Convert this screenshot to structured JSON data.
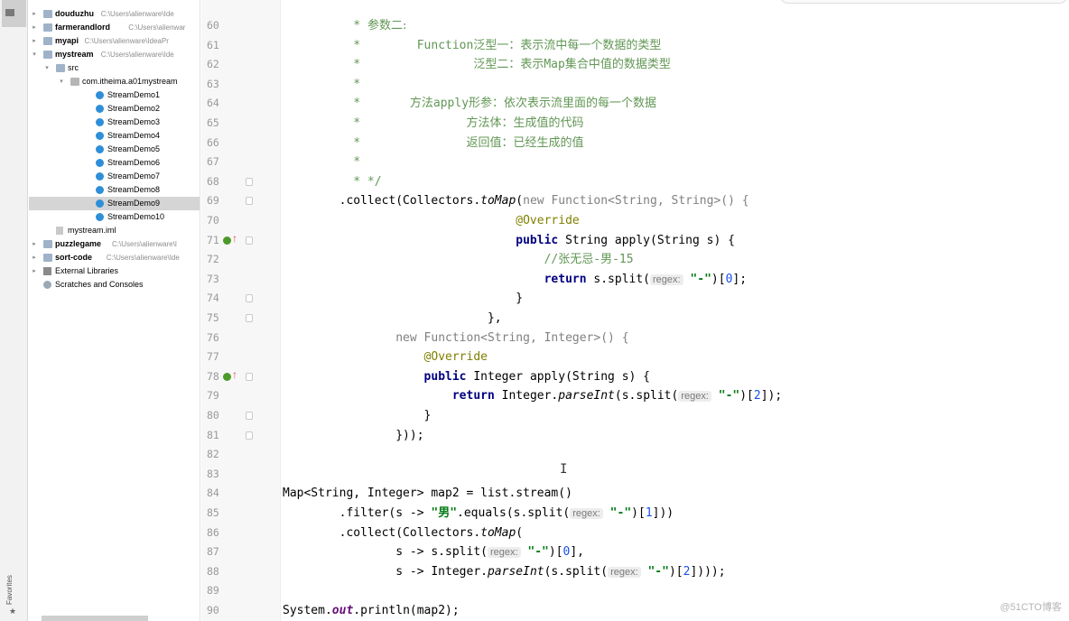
{
  "sidebar": {
    "favorites_label": "Favorites",
    "tree": [
      {
        "label": "douduzhu",
        "path": "C:\\Users\\alienware\\Ide",
        "bold": true,
        "level": 0,
        "icon": "folder-icon",
        "arrow": "right"
      },
      {
        "label": "farmerandlord",
        "path": "C:\\Users\\alienwar",
        "bold": true,
        "level": 0,
        "icon": "folder-icon",
        "arrow": "right"
      },
      {
        "label": "myapi",
        "path": "C:\\Users\\alienware\\IdeaPr",
        "bold": true,
        "level": 0,
        "icon": "folder-icon",
        "arrow": "right"
      },
      {
        "label": "mystream",
        "path": "C:\\Users\\alienware\\Ide",
        "bold": true,
        "level": 0,
        "icon": "folder-icon",
        "arrow": "down"
      },
      {
        "label": "src",
        "path": "",
        "bold": false,
        "level": 1,
        "icon": "folder-icon",
        "arrow": "down"
      },
      {
        "label": "com.itheima.a01mystream",
        "path": "",
        "bold": false,
        "level": 2,
        "icon": "package-icon",
        "arrow": "down"
      },
      {
        "label": "StreamDemo1",
        "path": "",
        "bold": false,
        "level": 3,
        "icon": "class-icon",
        "arrow": ""
      },
      {
        "label": "StreamDemo2",
        "path": "",
        "bold": false,
        "level": 3,
        "icon": "class-icon",
        "arrow": ""
      },
      {
        "label": "StreamDemo3",
        "path": "",
        "bold": false,
        "level": 3,
        "icon": "class-icon",
        "arrow": ""
      },
      {
        "label": "StreamDemo4",
        "path": "",
        "bold": false,
        "level": 3,
        "icon": "class-icon",
        "arrow": ""
      },
      {
        "label": "StreamDemo5",
        "path": "",
        "bold": false,
        "level": 3,
        "icon": "class-icon",
        "arrow": ""
      },
      {
        "label": "StreamDemo6",
        "path": "",
        "bold": false,
        "level": 3,
        "icon": "class-icon",
        "arrow": ""
      },
      {
        "label": "StreamDemo7",
        "path": "",
        "bold": false,
        "level": 3,
        "icon": "class-icon",
        "arrow": ""
      },
      {
        "label": "StreamDemo8",
        "path": "",
        "bold": false,
        "level": 3,
        "icon": "class-icon",
        "arrow": ""
      },
      {
        "label": "StreamDemo9",
        "path": "",
        "bold": false,
        "level": 3,
        "icon": "class-icon",
        "arrow": "",
        "selected": true
      },
      {
        "label": "StreamDemo10",
        "path": "",
        "bold": false,
        "level": 3,
        "icon": "class-icon",
        "arrow": ""
      },
      {
        "label": "mystream.iml",
        "path": "",
        "bold": false,
        "level": 1,
        "icon": "module-file-icon",
        "arrow": ""
      },
      {
        "label": "puzzlegame",
        "path": "C:\\Users\\alienware\\I",
        "bold": true,
        "level": 0,
        "icon": "folder-icon",
        "arrow": "right"
      },
      {
        "label": "sort-code",
        "path": "C:\\Users\\alienware\\Ide",
        "bold": true,
        "level": 0,
        "icon": "folder-icon",
        "arrow": "right"
      },
      {
        "label": "External Libraries",
        "path": "",
        "bold": false,
        "level": 0,
        "icon": "library-icon",
        "arrow": "right"
      },
      {
        "label": "Scratches and Consoles",
        "path": "",
        "bold": false,
        "level": 0,
        "icon": "scratches-icon",
        "arrow": ""
      }
    ]
  },
  "editor": {
    "lines": [
      {
        "n": 60,
        "markers": [],
        "segs": [
          {
            "t": "         ",
            "c": ""
          },
          {
            "t": " * ",
            "c": "cmt"
          },
          {
            "t": "参数二:",
            "c": "cmt-cn"
          }
        ]
      },
      {
        "n": 61,
        "markers": [],
        "segs": [
          {
            "t": "          *        ",
            "c": "cmt"
          },
          {
            "t": "Function",
            "c": "cmt"
          },
          {
            "t": "泛型一：表示流中每一个数据的类型",
            "c": "cmt-cn"
          }
        ]
      },
      {
        "n": 62,
        "markers": [],
        "segs": [
          {
            "t": "          *                ",
            "c": "cmt"
          },
          {
            "t": "泛型二：表示",
            "c": "cmt-cn"
          },
          {
            "t": "Map",
            "c": "cmt"
          },
          {
            "t": "集合中值的数据类型",
            "c": "cmt-cn"
          }
        ]
      },
      {
        "n": 63,
        "markers": [],
        "segs": [
          {
            "t": "          *",
            "c": "cmt"
          }
        ]
      },
      {
        "n": 64,
        "markers": [],
        "segs": [
          {
            "t": "          *       ",
            "c": "cmt"
          },
          {
            "t": "方法",
            "c": "cmt-cn"
          },
          {
            "t": "apply",
            "c": "cmt"
          },
          {
            "t": "形参：依次表示流里面的每一个数据",
            "c": "cmt-cn"
          }
        ]
      },
      {
        "n": 65,
        "markers": [],
        "segs": [
          {
            "t": "          *               ",
            "c": "cmt"
          },
          {
            "t": "方法体：生成值的代码",
            "c": "cmt-cn"
          }
        ]
      },
      {
        "n": 66,
        "markers": [],
        "segs": [
          {
            "t": "          *               ",
            "c": "cmt"
          },
          {
            "t": "返回值：已经生成的值",
            "c": "cmt-cn"
          }
        ]
      },
      {
        "n": 67,
        "markers": [],
        "segs": [
          {
            "t": "          *",
            "c": "cmt"
          }
        ]
      },
      {
        "n": 68,
        "markers": [
          "fold"
        ],
        "segs": [
          {
            "t": "          * */",
            "c": "cmt"
          }
        ]
      },
      {
        "n": 69,
        "markers": [
          "fold"
        ],
        "segs": [
          {
            "t": "        .collect(Collectors.",
            "c": ""
          },
          {
            "t": "toMap",
            "c": "italic"
          },
          {
            "t": "(",
            "c": ""
          },
          {
            "t": "new ",
            "c": "dim"
          },
          {
            "t": "Function<String, String>() {",
            "c": "dim"
          }
        ]
      },
      {
        "n": 70,
        "markers": [],
        "segs": [
          {
            "t": "                                 ",
            "c": ""
          },
          {
            "t": "@Override",
            "c": "ann"
          }
        ]
      },
      {
        "n": 71,
        "markers": [
          "impl",
          "fold"
        ],
        "segs": [
          {
            "t": "                                 ",
            "c": ""
          },
          {
            "t": "public ",
            "c": "kw"
          },
          {
            "t": "String apply(String s) {",
            "c": ""
          }
        ]
      },
      {
        "n": 72,
        "markers": [],
        "segs": [
          {
            "t": "                                     ",
            "c": ""
          },
          {
            "t": "//张无忌-男-15",
            "c": "cmt"
          }
        ]
      },
      {
        "n": 73,
        "markers": [],
        "segs": [
          {
            "t": "                                     ",
            "c": ""
          },
          {
            "t": "return ",
            "c": "kw"
          },
          {
            "t": "s.split(",
            "c": ""
          },
          {
            "t": "regex:",
            "c": "hint"
          },
          {
            "t": " ",
            "c": ""
          },
          {
            "t": "\"-\"",
            "c": "str"
          },
          {
            "t": ")[",
            "c": ""
          },
          {
            "t": "0",
            "c": "num"
          },
          {
            "t": "];",
            "c": ""
          }
        ]
      },
      {
        "n": 74,
        "markers": [
          "fold"
        ],
        "segs": [
          {
            "t": "                                 }",
            "c": ""
          }
        ]
      },
      {
        "n": 75,
        "markers": [
          "fold"
        ],
        "segs": [
          {
            "t": "                             },",
            "c": ""
          }
        ]
      },
      {
        "n": 76,
        "markers": [],
        "segs": [
          {
            "t": "                ",
            "c": ""
          },
          {
            "t": "new ",
            "c": "dim"
          },
          {
            "t": "Function<String, Integer>() {",
            "c": "dim"
          }
        ]
      },
      {
        "n": 77,
        "markers": [],
        "segs": [
          {
            "t": "                    ",
            "c": ""
          },
          {
            "t": "@Override",
            "c": "ann"
          }
        ]
      },
      {
        "n": 78,
        "markers": [
          "impl",
          "fold"
        ],
        "segs": [
          {
            "t": "                    ",
            "c": ""
          },
          {
            "t": "public ",
            "c": "kw"
          },
          {
            "t": "Integer apply(String s) {",
            "c": ""
          }
        ]
      },
      {
        "n": 79,
        "markers": [],
        "segs": [
          {
            "t": "                        ",
            "c": ""
          },
          {
            "t": "return ",
            "c": "kw"
          },
          {
            "t": "Integer.",
            "c": ""
          },
          {
            "t": "parseInt",
            "c": "italic"
          },
          {
            "t": "(s.split(",
            "c": ""
          },
          {
            "t": "regex:",
            "c": "hint"
          },
          {
            "t": " ",
            "c": ""
          },
          {
            "t": "\"-\"",
            "c": "str"
          },
          {
            "t": ")[",
            "c": ""
          },
          {
            "t": "2",
            "c": "num"
          },
          {
            "t": "]);",
            "c": ""
          }
        ]
      },
      {
        "n": 80,
        "markers": [
          "fold"
        ],
        "segs": [
          {
            "t": "                    }",
            "c": ""
          }
        ]
      },
      {
        "n": 81,
        "markers": [
          "fold"
        ],
        "segs": [
          {
            "t": "                }));",
            "c": ""
          }
        ]
      },
      {
        "n": 82,
        "markers": [],
        "segs": []
      },
      {
        "n": 83,
        "markers": [],
        "segs": []
      },
      {
        "n": 84,
        "markers": [],
        "segs": [
          {
            "t": "Map<String, Integer> map2 = list.stream()",
            "c": ""
          }
        ]
      },
      {
        "n": 85,
        "markers": [],
        "segs": [
          {
            "t": "        .filter(s -> ",
            "c": ""
          },
          {
            "t": "\"男\"",
            "c": "str"
          },
          {
            "t": ".equals(s.split(",
            "c": ""
          },
          {
            "t": "regex:",
            "c": "hint"
          },
          {
            "t": " ",
            "c": ""
          },
          {
            "t": "\"-\"",
            "c": "str"
          },
          {
            "t": ")[",
            "c": ""
          },
          {
            "t": "1",
            "c": "num"
          },
          {
            "t": "]))",
            "c": ""
          }
        ]
      },
      {
        "n": 86,
        "markers": [],
        "segs": [
          {
            "t": "        .collect(Collectors.",
            "c": ""
          },
          {
            "t": "toMap",
            "c": "italic"
          },
          {
            "t": "(",
            "c": ""
          }
        ]
      },
      {
        "n": 87,
        "markers": [],
        "segs": [
          {
            "t": "                s -> s.split(",
            "c": ""
          },
          {
            "t": "regex:",
            "c": "hint"
          },
          {
            "t": " ",
            "c": ""
          },
          {
            "t": "\"-\"",
            "c": "str"
          },
          {
            "t": ")[",
            "c": ""
          },
          {
            "t": "0",
            "c": "num"
          },
          {
            "t": "],",
            "c": ""
          }
        ]
      },
      {
        "n": 88,
        "markers": [],
        "segs": [
          {
            "t": "                s -> Integer.",
            "c": ""
          },
          {
            "t": "parseInt",
            "c": "italic"
          },
          {
            "t": "(s.split(",
            "c": ""
          },
          {
            "t": "regex:",
            "c": "hint"
          },
          {
            "t": " ",
            "c": ""
          },
          {
            "t": "\"-\"",
            "c": "str"
          },
          {
            "t": ")[",
            "c": ""
          },
          {
            "t": "2",
            "c": "num"
          },
          {
            "t": "])));",
            "c": ""
          }
        ]
      },
      {
        "n": 89,
        "markers": [],
        "segs": []
      },
      {
        "n": 90,
        "markers": [],
        "segs": [
          {
            "t": "System.",
            "c": ""
          },
          {
            "t": "out",
            "c": "fld"
          },
          {
            "t": ".println(map2);",
            "c": ""
          }
        ]
      }
    ],
    "caret_glyph": "I"
  },
  "watermark": "@51CTO博客"
}
